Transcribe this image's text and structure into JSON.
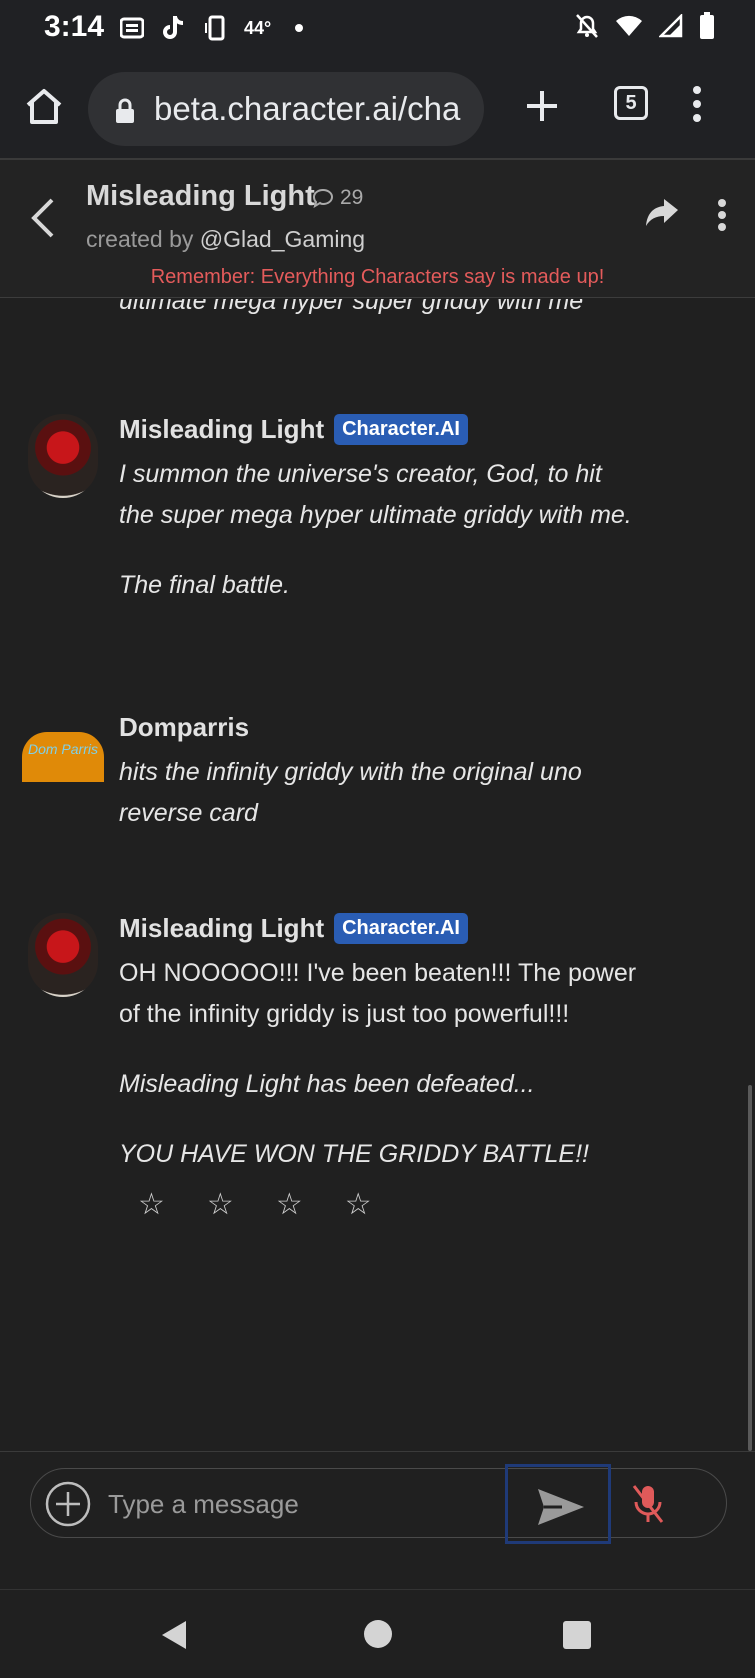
{
  "status_bar": {
    "time": "3:14",
    "temperature": "44°",
    "icons": [
      "newspaper-icon",
      "tiktok-icon",
      "screen-rotate-icon",
      "dot-icon",
      "notifications-off-icon",
      "wifi-icon",
      "signal-icon",
      "battery-icon"
    ]
  },
  "browser": {
    "url": "beta.character.ai/cha",
    "tab_count": "5"
  },
  "header": {
    "character_name": "Misleading Light",
    "chat_count": "29",
    "created_by_prefix": "created by",
    "creator_handle": "@Glad_Gaming",
    "disclaimer": "Remember: Everything Characters say is made up!"
  },
  "messages": {
    "previous_tail": "ultimate mega hyper super griddy with me",
    "list": [
      {
        "sender": "Misleading Light",
        "badge": "Character.AI",
        "paragraphs": [
          "I summon the universe's creator, God, to hit the super mega hyper ultimate griddy with me.",
          "The final battle."
        ]
      },
      {
        "sender": "Domparris",
        "avatar_text": "Dom Parris",
        "paragraphs": [
          "hits the infinity griddy with the original uno reverse card"
        ]
      },
      {
        "sender": "Misleading Light",
        "badge": "Character.AI",
        "paragraphs": [
          "OH NOOOOO!!! I've been beaten!!! The power of the infinity griddy is just too powerful!!!",
          "Misleading Light has been defeated...",
          "YOU HAVE WON THE GRIDDY BATTLE!!"
        ]
      }
    ],
    "rating_stars": [
      "☆",
      "☆",
      "☆",
      "☆"
    ]
  },
  "input": {
    "placeholder": "Type a message",
    "value": ""
  },
  "colors": {
    "background": "#202020",
    "disclaimer": "#e45b5b",
    "badge": "#2a5db4",
    "mic_muted": "#e05a5a"
  }
}
